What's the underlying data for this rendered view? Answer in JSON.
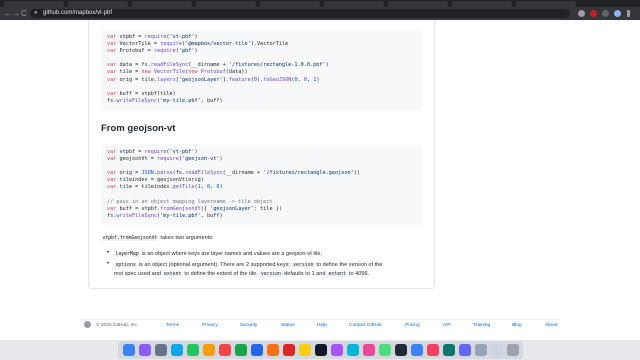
{
  "browser": {
    "url": "github.com/mapbox/vt-pbf",
    "nav_back": "←",
    "nav_forward": "→",
    "nav_reload": "C"
  },
  "code1": {
    "l1": [
      "var",
      " vtpbf = ",
      "require",
      "(",
      "'vt-pbf'",
      ")"
    ],
    "l2": [
      "var",
      " VectorTile = ",
      "require",
      "(",
      "'@mapbox/vector-tile'",
      ").VectorTile"
    ],
    "l3": [
      "var",
      " Protobuf = ",
      "require",
      "(",
      "'pbf'",
      ")"
    ],
    "l5": [
      "var",
      " data = fs.",
      "readFileSync",
      "(__dirname + ",
      "'/fixtures/rectangle-1.0.0.pbf'",
      ")"
    ],
    "l6": [
      "var",
      " tile = ",
      "new",
      " ",
      "VectorTile",
      "(",
      "new",
      " ",
      "Protobuf",
      "(data))"
    ],
    "l7": [
      "var",
      " orig = tile.",
      "layers",
      "[",
      "'geojsonLayer'",
      "].",
      "feature",
      "(",
      "0",
      ").",
      "toGeoJSON",
      "(",
      "0",
      ", ",
      "0",
      ", ",
      "1",
      ")"
    ],
    "l9": [
      "var",
      " buff = vtpbf(tile)"
    ],
    "l10": [
      "fs.",
      "writeFileSync",
      "(",
      "'my-tile.pbf'",
      ", buff)"
    ]
  },
  "heading": "From geojson-vt",
  "code2": {
    "l1": [
      "var",
      " vtpbf = ",
      "require",
      "(",
      "'vt-pbf'",
      ")"
    ],
    "l2": [
      "var",
      " geojsonVt = ",
      "require",
      "(",
      "'geojson-vt'",
      ")"
    ],
    "l4": [
      "var",
      " orig = ",
      "JSON",
      ".",
      "parse",
      "(fs.",
      "readFileSync",
      "(__dirname + ",
      "'/fixtures/rectangle.geojson'",
      "))"
    ],
    "l5": [
      "var",
      " tileindex = geojsonVt(orig)"
    ],
    "l6": [
      "var",
      " tile = tileindex.",
      "getTile",
      "(",
      "1",
      ", ",
      "0",
      ", ",
      "0",
      ")"
    ],
    "l8": "// pass in an object mapping layername -> tile object",
    "l9": [
      "var",
      " buff = vtpbf.",
      "fromGeojsonVt",
      "({ ",
      "'geojsonLayer'",
      ": tile })"
    ],
    "l10": [
      "fs.",
      "writeFileSync",
      "(",
      "'my-tile.pbf'",
      ", buff)"
    ]
  },
  "prose": {
    "fn_code": "vtpbf.fromGeojsonVt",
    "fn_text": " takes two arguments:",
    "b1_code": "layerMap",
    "b1_text": " is an object where keys are layer names and values are a geojson-vt tile,",
    "b2_code": "options",
    "b2_text_a": " is an object (optional argument). There are 2 supported keys: ",
    "b2_code_b": "version",
    "b2_text_b": " to define the version of the",
    "b2_line2_a": "mvt spec used and ",
    "b2_code_c": "extent",
    "b2_text_c": " to define the extent of the tile. ",
    "b2_code_d": "version",
    "b2_text_d": " defaults to 1 and ",
    "b2_code_e": "extent",
    "b2_text_e": " to 4096."
  },
  "footer": {
    "copyright": "© 2020 GitHub, Inc.",
    "links": [
      "Terms",
      "Privacy",
      "Security",
      "Status",
      "Help",
      "Contact GitHub",
      "Pricing",
      "API",
      "Training",
      "Blog",
      "About"
    ]
  }
}
